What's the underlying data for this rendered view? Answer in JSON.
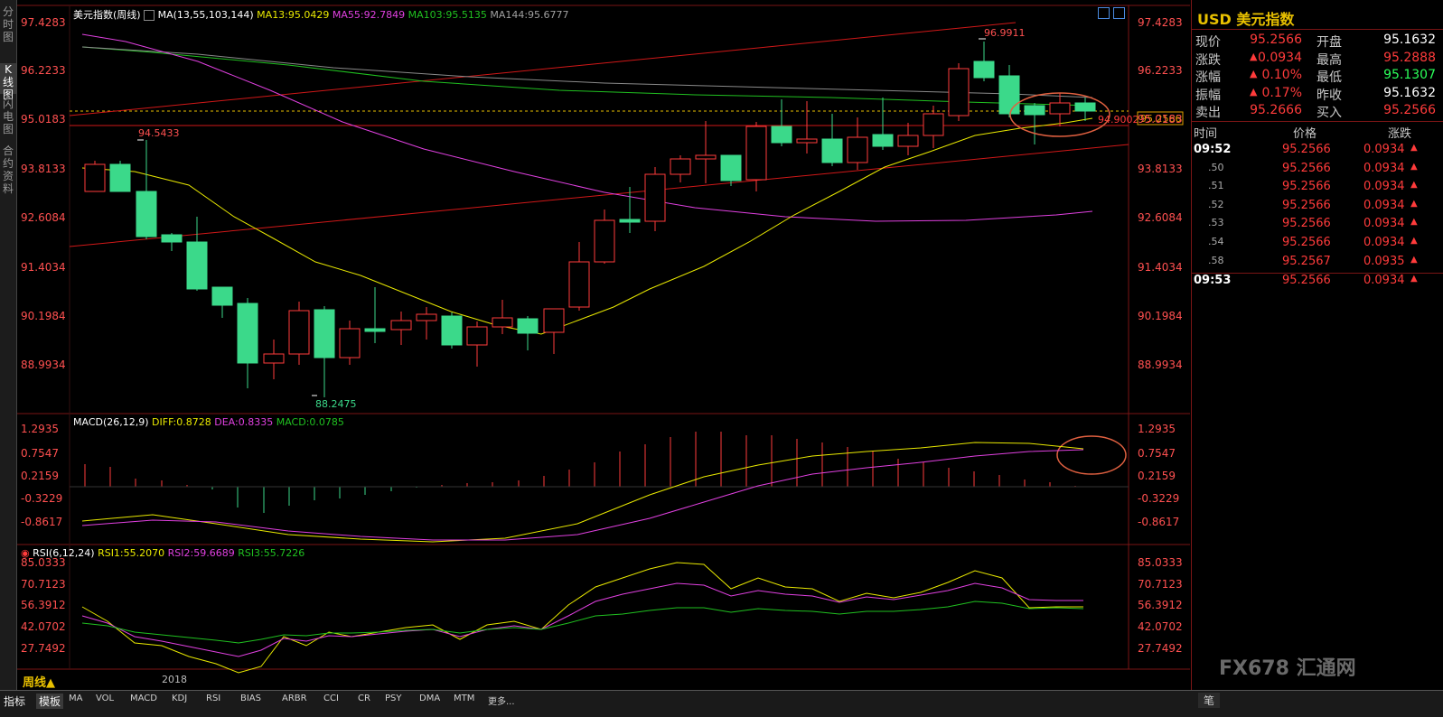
{
  "left_tabs": [
    "分时图",
    "K线图",
    "闪电图",
    "合约资料"
  ],
  "main_header": {
    "title": "美元指数(周线)",
    "ma_label": "MA(13,55,103,144)",
    "ma13": "MA13:95.0429",
    "ma55": "MA55:92.7849",
    "ma103": "MA103:95.5135",
    "ma144": "MA144:95.6777"
  },
  "price_axis": [
    "97.4283",
    "96.2233",
    "95.0183",
    "93.8133",
    "92.6084",
    "91.4034",
    "90.1984",
    "88.9934"
  ],
  "annotations": {
    "high": "96.9911",
    "peak_left": "94.5433",
    "low": "88.2475",
    "level": "94.9002",
    "current": "95.2566"
  },
  "macd_header": {
    "label": "MACD(26,12,9)",
    "diff": "DIFF:0.8728",
    "dea": "DEA:0.8335",
    "macd": "MACD:0.0785"
  },
  "macd_axis": [
    "1.2935",
    "0.7547",
    "0.2159",
    "-0.3229",
    "-0.8617"
  ],
  "rsi_header": {
    "label": "RSI(6,12,24)",
    "rsi1": "RSI1:55.2070",
    "rsi2": "RSI2:59.6689",
    "rsi3": "RSI3:55.7226"
  },
  "rsi_axis": [
    "85.0333",
    "70.7123",
    "56.3912",
    "42.0702",
    "27.7492"
  ],
  "period_label": "周线▲",
  "year_label": "2018",
  "bottom_tabs": [
    "指标",
    "模板",
    "MA",
    "VOL",
    "MACD",
    "KDJ",
    "RSI",
    "BIAS",
    "ARBR",
    "CCI",
    "CR",
    "PSY",
    "DMA",
    "MTM",
    "更多..."
  ],
  "right_panel": {
    "title_code": "USD",
    "title_name": "美元指数",
    "quote": [
      {
        "l1": "现价",
        "v1": "95.2566",
        "c1": "red",
        "l2": "开盘",
        "v2": "95.1632",
        "c2": "white"
      },
      {
        "l1": "涨跌",
        "v1": "0.0934",
        "c1": "red",
        "l2": "最高",
        "v2": "95.2888",
        "c2": "red"
      },
      {
        "l1": "涨幅",
        "v1": "0.10%",
        "c1": "red",
        "l2": "最低",
        "v2": "95.1307",
        "c2": "green"
      },
      {
        "l1": "振幅",
        "v1": "0.17%",
        "c1": "red",
        "l2": "昨收",
        "v2": "95.1632",
        "c2": "white"
      },
      {
        "l1": "卖出",
        "v1": "95.2666",
        "c1": "red",
        "l2": "买入",
        "v2": "95.2566",
        "c2": "red"
      }
    ],
    "ticks_header": {
      "time": "时间",
      "price": "价格",
      "change": "涨跌"
    },
    "ticks": [
      {
        "t": "09:52",
        "p": "95.2566",
        "c": "0.0934"
      },
      {
        "t": ".50",
        "p": "95.2566",
        "c": "0.0934"
      },
      {
        "t": ".51",
        "p": "95.2566",
        "c": "0.0934"
      },
      {
        "t": ".52",
        "p": "95.2566",
        "c": "0.0934"
      },
      {
        "t": ".53",
        "p": "95.2566",
        "c": "0.0934"
      },
      {
        "t": ".54",
        "p": "95.2566",
        "c": "0.0934"
      },
      {
        "t": ".58",
        "p": "95.2567",
        "c": "0.0935"
      },
      {
        "t": "09:53",
        "p": "95.2566",
        "c": "0.0934"
      }
    ],
    "watermark": "FX678 汇通网",
    "bottom_label": "笔"
  },
  "colors": {
    "up": "#ff3b3b",
    "down": "#3bd98a",
    "ma13": "#e8e800",
    "ma55": "#e040e0",
    "ma103": "#20c020",
    "ma144": "#a0a0a0",
    "trend": "#d01818",
    "circle": "#e06040"
  }
}
